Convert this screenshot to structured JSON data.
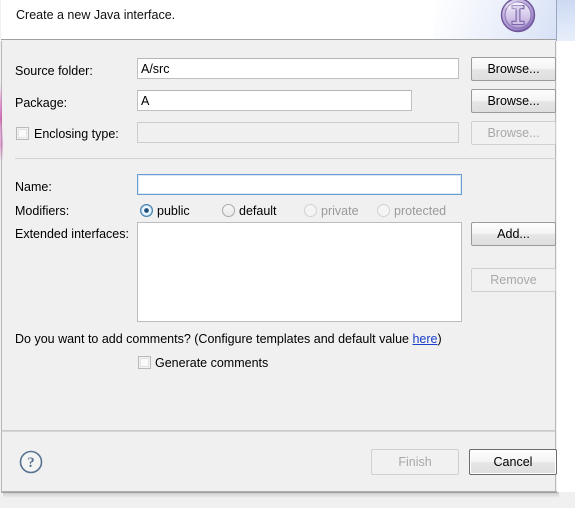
{
  "dialog": {
    "title": "Create a new Java interface.",
    "icon": "java-interface-badge-icon"
  },
  "form": {
    "source_folder": {
      "label": "Source folder:",
      "value": "A/src",
      "browse_label": "Browse...",
      "enabled": true
    },
    "package": {
      "label": "Package:",
      "value": "A",
      "browse_label": "Browse...",
      "enabled": true
    },
    "enclosing_type": {
      "label": "Enclosing type:",
      "value": "",
      "checked": false,
      "browse_label": "Browse...",
      "enabled": false
    },
    "name": {
      "label": "Name:",
      "value": "",
      "focused": true
    },
    "modifiers": {
      "label": "Modifiers:",
      "options": [
        {
          "label": "public",
          "selected": true,
          "enabled": true
        },
        {
          "label": "default",
          "selected": false,
          "enabled": true
        },
        {
          "label": "private",
          "selected": false,
          "enabled": false
        },
        {
          "label": "protected",
          "selected": false,
          "enabled": false
        }
      ]
    },
    "extended_interfaces": {
      "label": "Extended interfaces:",
      "items": [],
      "add_label": "Add...",
      "remove_label": "Remove",
      "remove_enabled": false
    },
    "comments": {
      "question_prefix": "Do you want to add comments? (Configure templates and default value ",
      "link_text": "here",
      "question_suffix": ")",
      "generate_label": "Generate comments",
      "generate_checked": false
    }
  },
  "footer": {
    "help_icon": "help-question-icon",
    "finish_label": "Finish",
    "finish_enabled": false,
    "cancel_label": "Cancel",
    "cancel_enabled": true
  },
  "colors": {
    "link": "#1a3fc8",
    "body_bg": "#f0f0f0",
    "header_bg": "#ffffff",
    "radio_accent": "#1f4f7a",
    "icon_purple": "#9b87c4"
  }
}
